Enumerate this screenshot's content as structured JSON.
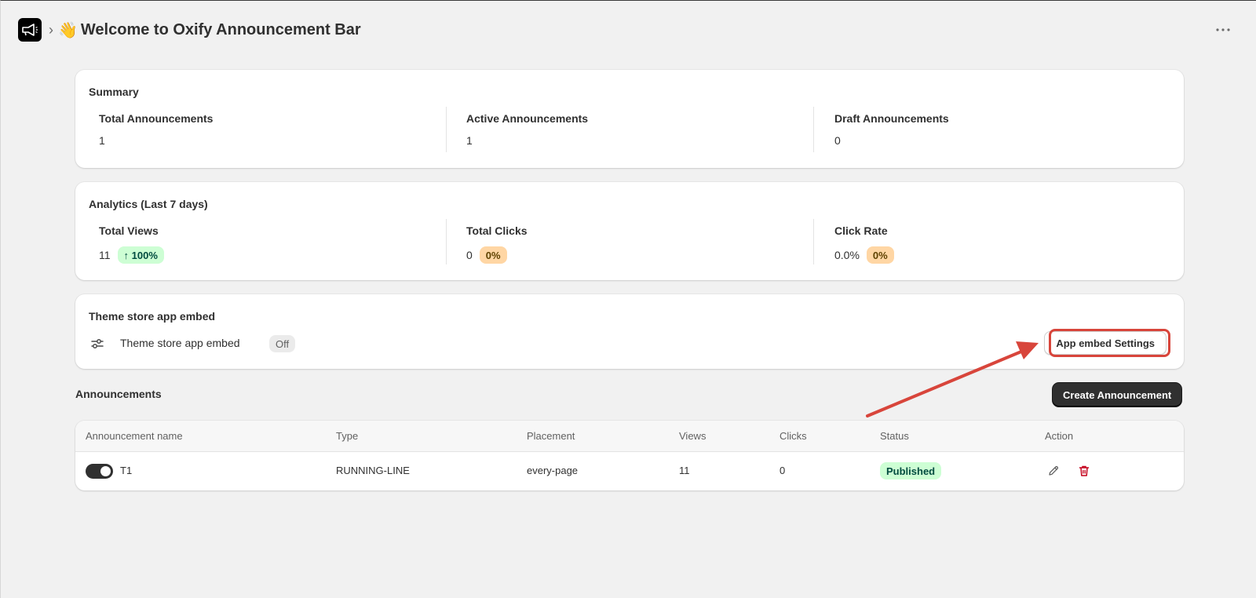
{
  "header": {
    "breadcrumb_chevron": "›",
    "title_emoji": "👋",
    "title": "Welcome to Oxify Announcement Bar",
    "more_label": "···"
  },
  "summary": {
    "title": "Summary",
    "stats": [
      {
        "label": "Total Announcements",
        "value": "1"
      },
      {
        "label": "Active Announcements",
        "value": "1"
      },
      {
        "label": "Draft Announcements",
        "value": "0"
      }
    ]
  },
  "analytics": {
    "title": "Analytics (Last 7 days)",
    "stats": [
      {
        "label": "Total Views",
        "value": "11",
        "badge": "↑ 100%",
        "badge_color": "#cdfed4"
      },
      {
        "label": "Total Clicks",
        "value": "0",
        "badge": "0%",
        "badge_color": "#ffd6a4"
      },
      {
        "label": "Click Rate",
        "value": "0.0%",
        "badge": "0%",
        "badge_color": "#ffd6a4"
      }
    ]
  },
  "embed": {
    "title": "Theme store app embed",
    "row_label": "Theme store app embed",
    "status": "Off",
    "settings_button": "App embed Settings",
    "highlight_color": "#d8453b"
  },
  "announcements": {
    "heading": "Announcements",
    "create_button": "Create Announcement",
    "columns": [
      "Announcement name",
      "Type",
      "Placement",
      "Views",
      "Clicks",
      "Status",
      "Action"
    ],
    "rows": [
      {
        "enabled": true,
        "name": "T1",
        "type": "RUNNING-LINE",
        "placement": "every-page",
        "views": "11",
        "clicks": "0",
        "status": "Published",
        "actions": [
          "pencil-icon",
          "trash-icon"
        ]
      }
    ]
  }
}
